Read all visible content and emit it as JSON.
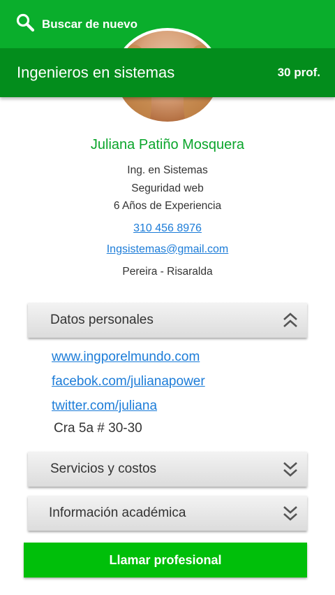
{
  "search": {
    "label": "Buscar de nuevo",
    "icon": "search-icon"
  },
  "header": {
    "title": "Ingenieros en sistemas",
    "count": "30 prof."
  },
  "profile": {
    "name": "Juliana Patiño Mosquera",
    "profession": "Ing. en Sistemas",
    "specialty": "Seguridad web",
    "experience": "6 Años de Experiencia",
    "phone": "310 456 8976",
    "email": "Ingsistemas@gmail.com",
    "location": "Pereira - Risaralda"
  },
  "sections": {
    "personal": {
      "label": "Datos personales",
      "state": "expanded"
    },
    "services": {
      "label": "Servicios y costos",
      "state": "collapsed"
    },
    "academic": {
      "label": "Información académica",
      "state": "collapsed"
    }
  },
  "personal_data": {
    "website": "www.ingporelmundo.com",
    "facebook": "facebok.com/julianapower",
    "twitter": "twitter.com/juliana",
    "address": "Cra 5a # 30-30"
  },
  "call_button": {
    "label": "Llamar profesional"
  },
  "colors": {
    "search_bar": "#0aae2c",
    "title_bar": "#038d1c",
    "name": "#0aa52b",
    "link": "#1c7cd8",
    "button": "#00bf0a"
  }
}
